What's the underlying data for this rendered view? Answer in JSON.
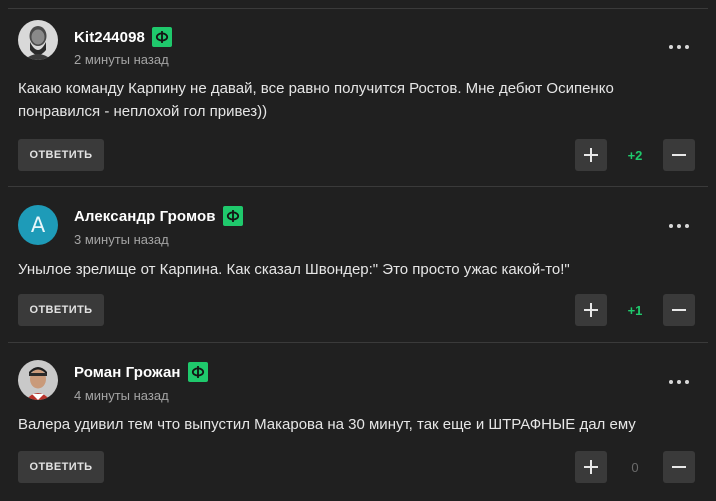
{
  "comments": [
    {
      "author": "Kit244098",
      "timestamp": "2 минуты назад",
      "avatar": "photo-man-beard",
      "text": "Какаю команду Карпину не давай, все равно получится Ростов. Мне дебют Осипенко понравился - неплохой гол привез))",
      "reply_label": "ОТВЕТИТЬ",
      "score": "+2"
    },
    {
      "author": "Александр Громов",
      "timestamp": "3 минуты назад",
      "avatar_letter": "А",
      "text": "Унылое зрелище от Карпина. Как сказал Швондер:\" Это просто ужас какой-то!\"",
      "reply_label": "ОТВЕТИТЬ",
      "score": "+1"
    },
    {
      "author": "Роман Грожан",
      "timestamp": "4 минуты назад",
      "avatar": "photo-man-helmet",
      "text": "Валера удивил тем что выпустил Макарова на 30 минут, так еще и ШТРАФНЫЕ дал ему",
      "reply_label": "ОТВЕТИТЬ",
      "score": "0"
    }
  ],
  "colors": {
    "background": "#202020",
    "badge": "#1fc96c",
    "button": "#3a3a3a",
    "score_positive": "#1fc96c",
    "avatar_letter_bg": "#1e9bb8"
  },
  "icons": {
    "badge": "fonbet-badge-icon",
    "menu": "more-dots-icon",
    "upvote": "plus-icon",
    "downvote": "minus-icon"
  }
}
